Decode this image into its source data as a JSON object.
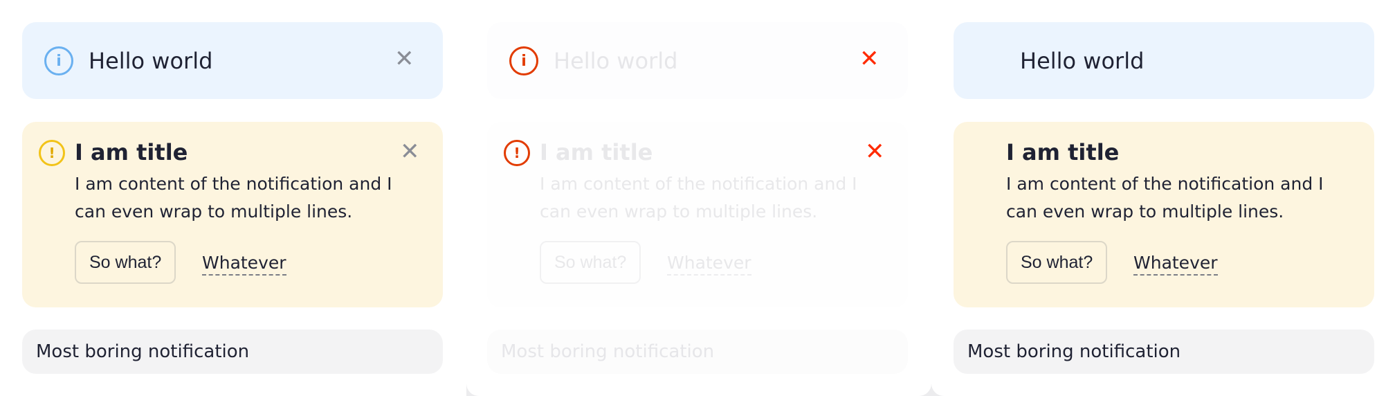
{
  "panels": [
    {
      "info": {
        "message": "Hello world",
        "icon": "info-icon",
        "close_icon": "close-icon"
      },
      "warning": {
        "title": "I am title",
        "content": "I am content of the notification and I can even wrap to multiple lines.",
        "primary_action": "So what?",
        "secondary_action": "Whatever",
        "icon": "warning-icon",
        "close_icon": "close-icon"
      },
      "plain": {
        "message": "Most boring notification"
      }
    },
    {
      "info": {
        "message": "Hello world",
        "icon": "info-icon",
        "close_icon": "close-icon"
      },
      "warning": {
        "title": "I am title",
        "content": "I am content of the notification and I can even wrap to multiple lines.",
        "primary_action": "So what?",
        "secondary_action": "Whatever",
        "icon": "warning-icon",
        "close_icon": "close-icon"
      },
      "plain": {
        "message": "Most boring notification"
      }
    },
    {
      "info": {
        "message": "Hello world"
      },
      "warning": {
        "title": "I am title",
        "content": "I am content of the notification and I can even wrap to multiple lines.",
        "primary_action": "So what?",
        "secondary_action": "Whatever"
      },
      "plain": {
        "message": "Most boring notification"
      }
    }
  ],
  "glyphs": {
    "info": "i",
    "warning": "!",
    "close": "✕"
  },
  "colors": {
    "info_bg": "#ebf4fe",
    "warning_bg": "#fdf5df",
    "plain_bg": "#f3f3f4",
    "info_icon": "#6ab0f0",
    "warning_icon": "#f2c318",
    "accent_red": "#e23b00"
  }
}
